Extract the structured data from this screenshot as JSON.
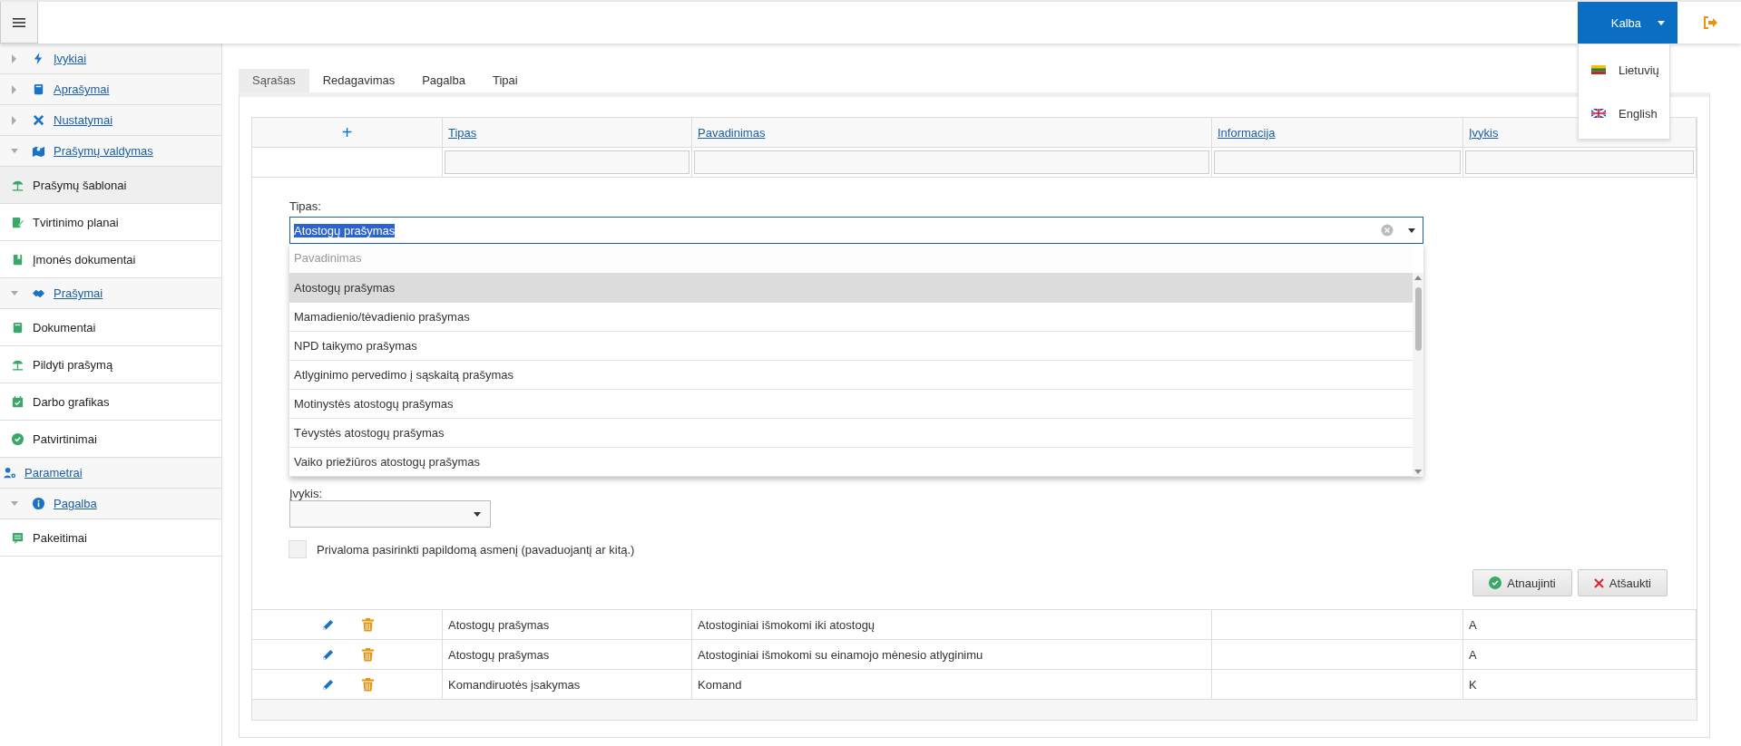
{
  "header": {
    "language_button": {
      "label": "Kalba",
      "expanded": true
    },
    "language_menu": [
      {
        "label": "Lietuvių"
      },
      {
        "label": "English"
      }
    ]
  },
  "sidebar": {
    "items": [
      {
        "label": "Įvykiai",
        "kind": "group",
        "expanded": false
      },
      {
        "label": "Aprašymai",
        "kind": "group",
        "expanded": false
      },
      {
        "label": "Nustatymai",
        "kind": "group",
        "expanded": false
      },
      {
        "label": "Prašymų valdymas",
        "kind": "group",
        "expanded": true,
        "children": [
          {
            "label": "Prašymų šablonai",
            "kind": "page",
            "selected": true
          },
          {
            "label": "Tvirtinimo planai",
            "kind": "page",
            "selected": false
          },
          {
            "label": "Įmonės dokumentai",
            "kind": "page",
            "selected": false
          },
          {
            "label": "Prašymai",
            "kind": "group",
            "expanded": true,
            "children": [
              {
                "label": "Dokumentai",
                "kind": "page",
                "selected": false
              },
              {
                "label": "Pildyti prašymą",
                "kind": "page",
                "selected": false
              },
              {
                "label": "Darbo grafikas",
                "kind": "page",
                "selected": false
              },
              {
                "label": "Patvirtinimai",
                "kind": "page",
                "selected": false
              }
            ]
          }
        ]
      },
      {
        "label": "Parametrai",
        "kind": "link"
      },
      {
        "label": "Pagalba",
        "kind": "group",
        "expanded": true,
        "children": [
          {
            "label": "Pakeitimai",
            "kind": "page",
            "selected": false
          }
        ]
      }
    ]
  },
  "tabs": [
    {
      "label": "Sąrašas",
      "selected": true
    },
    {
      "label": "Redagavimas",
      "selected": false
    },
    {
      "label": "Pagalba",
      "selected": false
    },
    {
      "label": "Tipai",
      "selected": false
    }
  ],
  "table": {
    "add_symbol": "+",
    "columns": [
      "Tipas",
      "Pavadinimas",
      "Informacija",
      "Įvykis"
    ],
    "rows": [
      {
        "tipas": "Atostogų prašymas",
        "pavadinimas": "Atostoginiai išmokomi iki atostogų",
        "informacija": "",
        "ivykis": "A"
      },
      {
        "tipas": "Atostogų prašymas",
        "pavadinimas": "Atostoginiai išmokomi su einamojo mėnesio atlyginimu",
        "informacija": "",
        "ivykis": "A"
      },
      {
        "tipas": "Komandiruotės įsakymas",
        "pavadinimas": "Komand",
        "informacija": "",
        "ivykis": "K"
      }
    ]
  },
  "form": {
    "tipas": {
      "label": "Tipas:",
      "value": "Atostogų prašymas",
      "expanded": true,
      "list_header": "Pavadinimas",
      "options": [
        {
          "label": "Atostogų prašymas",
          "selected": true
        },
        {
          "label": "Mamadienio/tėvadienio prašymas",
          "selected": false
        },
        {
          "label": "NPD taikymo prašymas",
          "selected": false
        },
        {
          "label": "Atlyginimo pervedimo į sąskaitą prašymas",
          "selected": false
        },
        {
          "label": "Motinystės atostogų prašymas",
          "selected": false
        },
        {
          "label": "Tėvystės atostogų prašymas",
          "selected": false
        },
        {
          "label": "Vaiko priežiūros atostogų prašymas",
          "selected": false
        }
      ]
    },
    "ivykis": {
      "label": "Įvykis:"
    },
    "checkbox": {
      "label": "Privaloma pasirinkti papildomą asmenį (pavaduojantį ar kitą.)",
      "checked": false
    },
    "buttons": [
      {
        "label": "Atnaujinti",
        "kind": "update"
      },
      {
        "label": "Atšaukti",
        "kind": "cancel"
      }
    ]
  }
}
